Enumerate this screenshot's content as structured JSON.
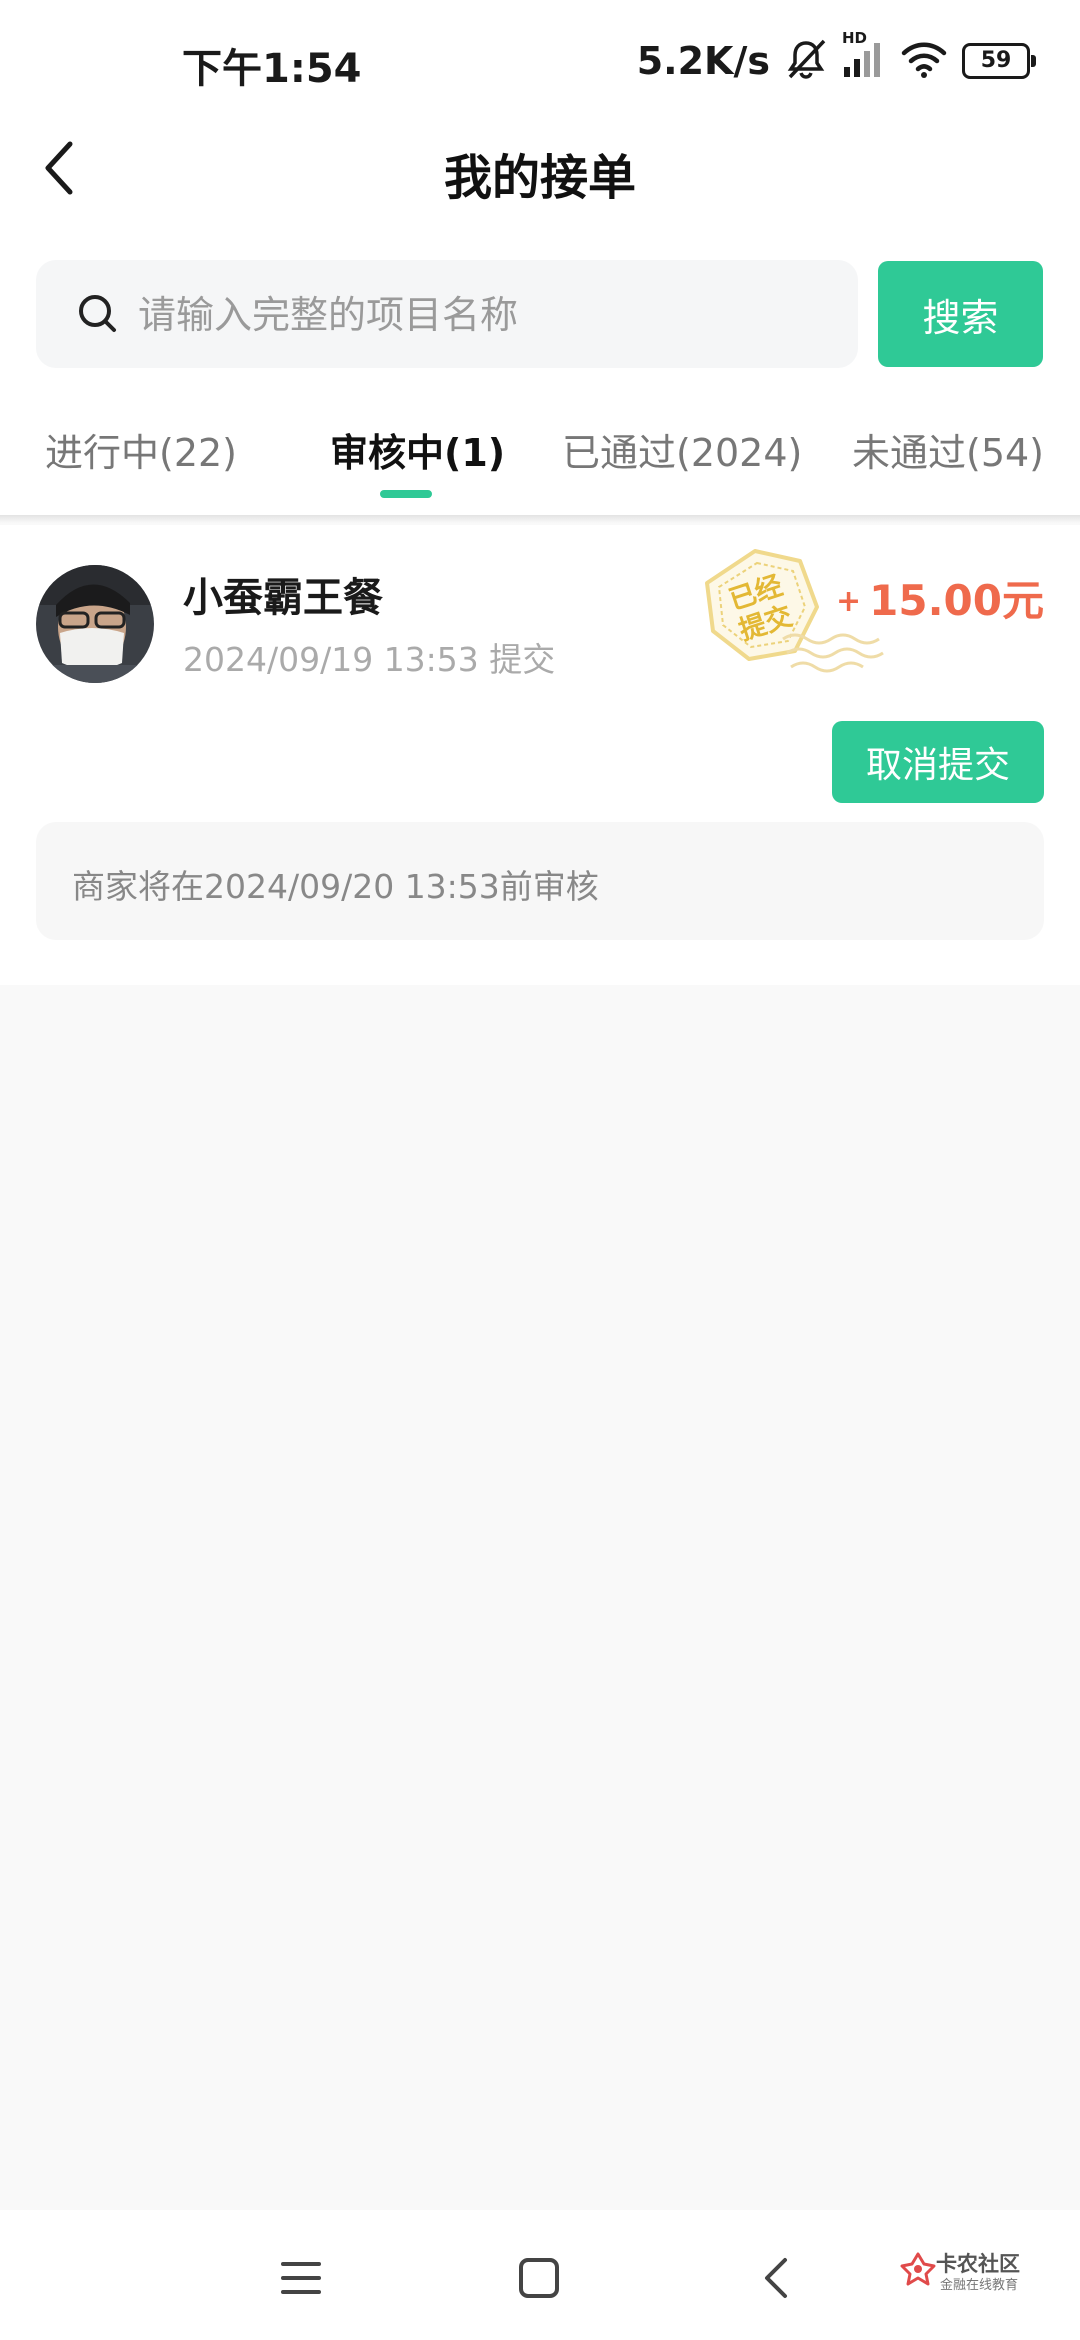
{
  "status_bar": {
    "time": "下午1:54",
    "net_speed": "5.2K/s",
    "network_badge": "HD",
    "battery": "59",
    "icons": [
      "mute-bell-icon",
      "signal-icon",
      "wifi-icon",
      "battery-icon"
    ]
  },
  "header": {
    "title": "我的接单",
    "back_icon": "chevron-left-icon"
  },
  "search": {
    "placeholder": "请输入完整的项目名称",
    "value": "",
    "button_label": "搜索",
    "icon": "search-icon"
  },
  "tabs": [
    {
      "label": "进行中(22)",
      "active": false
    },
    {
      "label": "审核中(1)",
      "active": true
    },
    {
      "label": "已通过(2024)",
      "active": false
    },
    {
      "label": "未通过(54)",
      "active": false
    }
  ],
  "order": {
    "name": "小蚕霸王餐",
    "time": "2024/09/19 13:53 提交",
    "stamp": "已经提交",
    "reward_sign": "+",
    "reward": "15.00元",
    "cancel_label": "取消提交",
    "note": "商家将在2024/09/20 13:53前审核"
  },
  "nav": {
    "icons": [
      "menu-icon",
      "home-square-icon",
      "back-icon"
    ],
    "watermark": {
      "title": "卡农社区",
      "subtitle": "金融在线教育"
    }
  },
  "colors": {
    "accent": "#2fc996",
    "reward": "#ef6a4c",
    "stamp": "#e8c35a",
    "background": "#f9f9f9"
  }
}
